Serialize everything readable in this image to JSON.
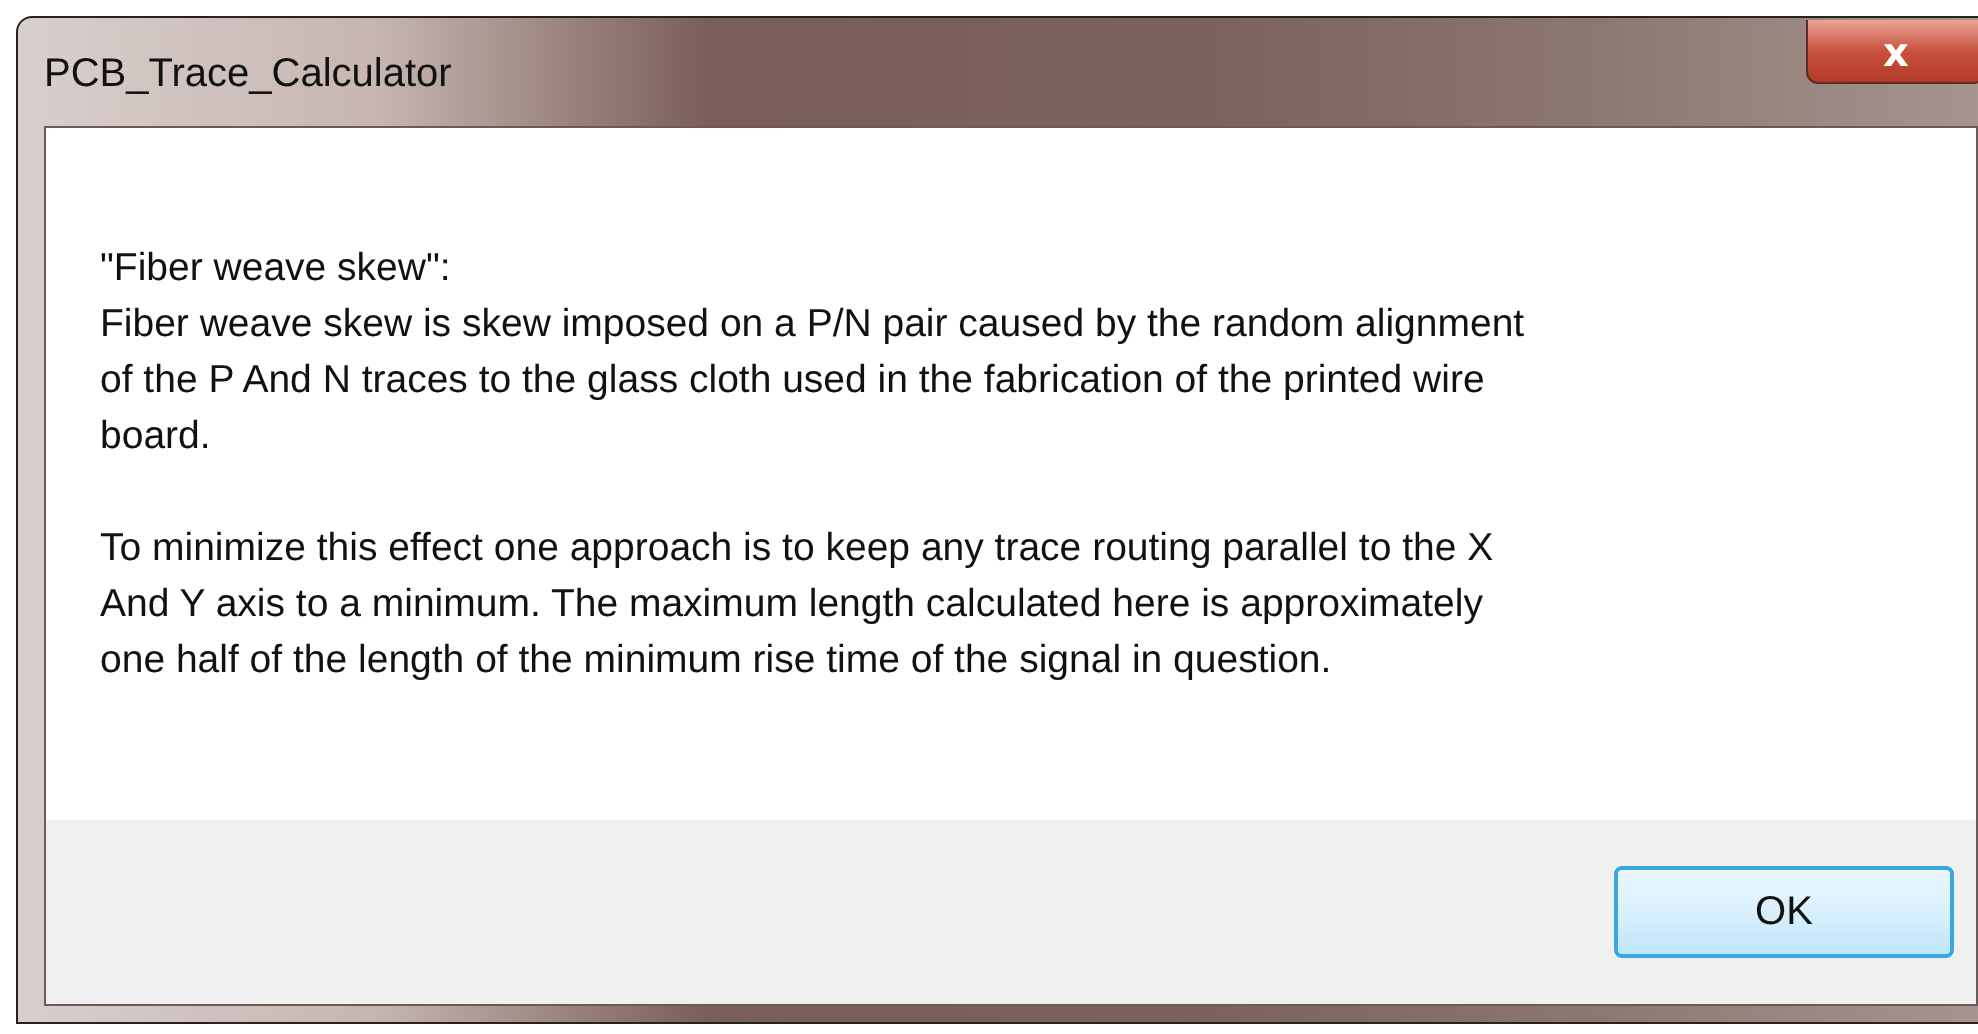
{
  "window": {
    "title": "PCB_Trace_Calculator",
    "close_label": "x"
  },
  "message": {
    "paragraphs": [
      "\"Fiber weave skew\":\nFiber weave skew is skew imposed on a P/N pair caused by the random alignment\nof the P And N traces to the glass cloth used in the fabrication of the printed wire\nboard.",
      "To minimize this effect one approach is to keep any trace routing parallel to the X\nAnd Y axis to a minimum. The maximum length calculated here is approximately\none half of the length of the minimum rise time of the signal in question."
    ]
  },
  "buttons": [
    "OK"
  ]
}
